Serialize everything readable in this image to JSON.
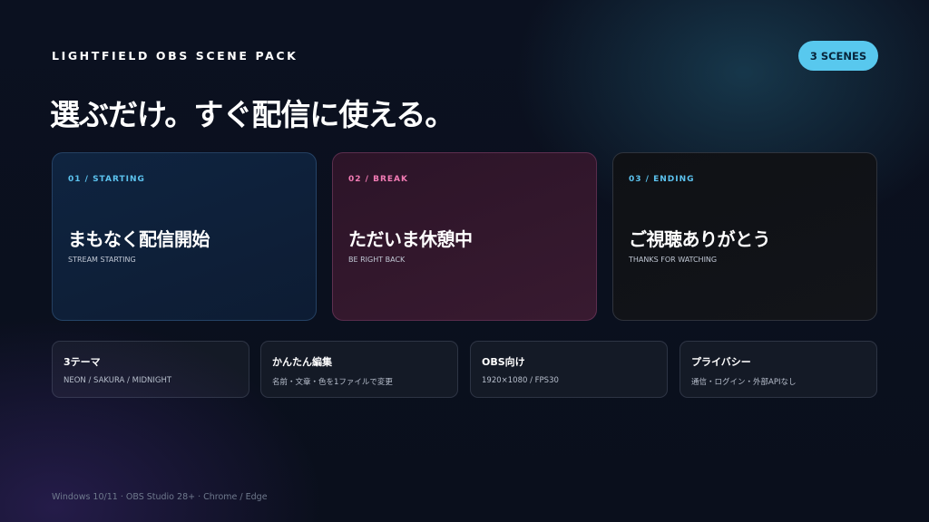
{
  "header": {
    "brand": "LIGHTFIELD OBS SCENE PACK",
    "badge": "3 SCENES",
    "headline": "選ぶだけ。すぐ配信に使える。"
  },
  "scenes": [
    {
      "tag": "01 / STARTING",
      "title": "まもなく配信開始",
      "subtitle": "STREAM STARTING",
      "accent": "#5cc3ef"
    },
    {
      "tag": "02 / BREAK",
      "title": "ただいま休憩中",
      "subtitle": "BE RIGHT BACK",
      "accent": "#f27bb4"
    },
    {
      "tag": "03 / ENDING",
      "title": "ご視聴ありがとう",
      "subtitle": "THANKS FOR WATCHING",
      "accent": "#5cc3ef"
    }
  ],
  "features": [
    {
      "title": "3テーマ",
      "subtitle": "NEON / SAKURA / MIDNIGHT"
    },
    {
      "title": "かんたん編集",
      "subtitle": "名前・文章・色を1ファイルで変更"
    },
    {
      "title": "OBS向け",
      "subtitle": "1920×1080 / FPS30"
    },
    {
      "title": "プライバシー",
      "subtitle": "通信・ログイン・外部APIなし"
    }
  ],
  "footer": {
    "requirements": "Windows 10/11 · OBS Studio 28+ · Chrome / Edge"
  },
  "colors": {
    "badge": "#58c8ee",
    "accent_cyan": "#5cc3ef",
    "accent_pink": "#f27bb4",
    "background": "#0a0f1c"
  }
}
